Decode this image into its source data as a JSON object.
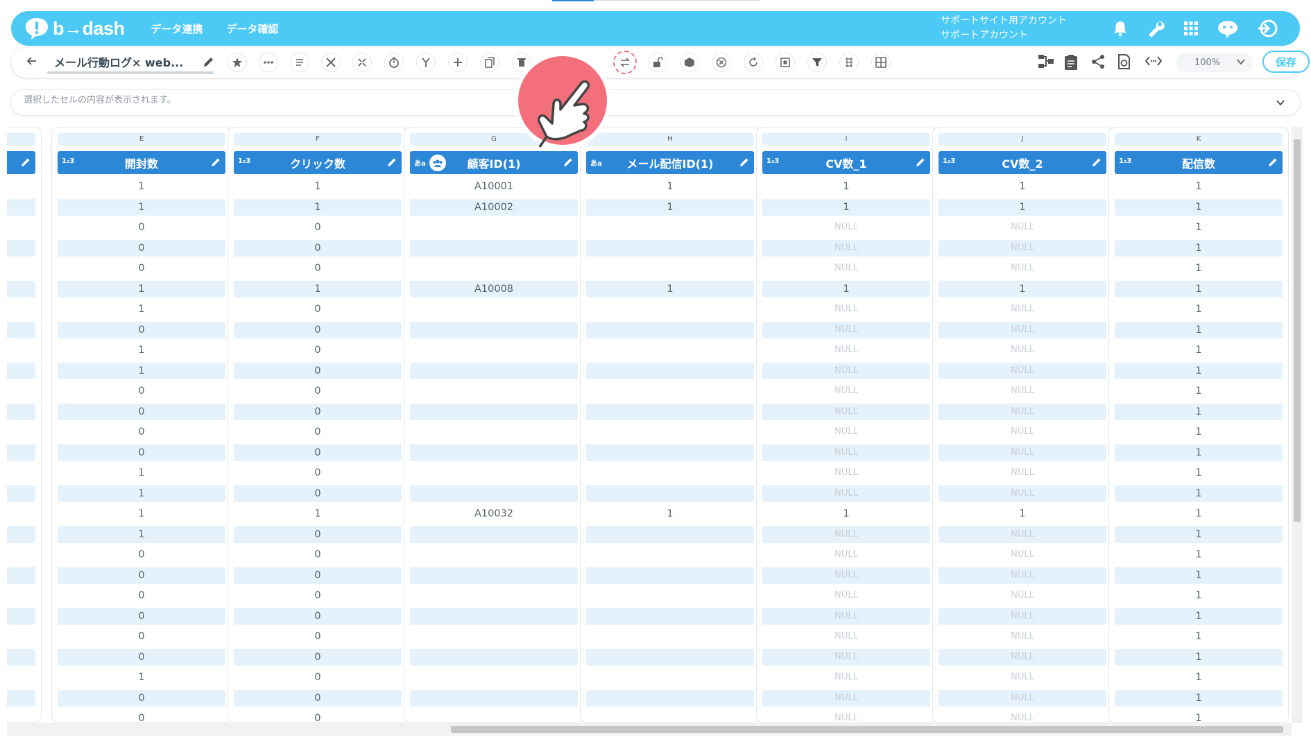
{
  "app": {
    "logo_text": "b→dash",
    "nav": [
      "データ連携",
      "データ確認"
    ],
    "account_line1": "サポートサイト用アカウント",
    "account_line2": "サポートアカウント"
  },
  "toolbar": {
    "title": "メール行動ログ× web...",
    "zoom": "100%",
    "save_label": "保存"
  },
  "formula": {
    "placeholder": "選択したセルの内容が表示されます。"
  },
  "columns": [
    {
      "letter": "",
      "name": "",
      "type": ""
    },
    {
      "letter": "E",
      "name": "開封数",
      "type": "1₂3"
    },
    {
      "letter": "F",
      "name": "クリック数",
      "type": "1₂3"
    },
    {
      "letter": "G",
      "name": "顧客ID(1)",
      "type": "あa"
    },
    {
      "letter": "H",
      "name": "メール配信ID(1)",
      "type": "あa"
    },
    {
      "letter": "I",
      "name": "CV数_1",
      "type": "1₂3"
    },
    {
      "letter": "J",
      "name": "CV数_2",
      "type": "1₂3"
    },
    {
      "letter": "K",
      "name": "配信数",
      "type": "1₂3"
    }
  ],
  "rows": [
    [
      "",
      "1",
      "1",
      "A10001",
      "1",
      "1",
      "1",
      "1"
    ],
    [
      "",
      "1",
      "1",
      "A10002",
      "1",
      "1",
      "1",
      "1"
    ],
    [
      "",
      "0",
      "0",
      "",
      "",
      "NULL",
      "NULL",
      "1"
    ],
    [
      "",
      "0",
      "0",
      "",
      "",
      "NULL",
      "NULL",
      "1"
    ],
    [
      "",
      "0",
      "0",
      "",
      "",
      "NULL",
      "NULL",
      "1"
    ],
    [
      "",
      "1",
      "1",
      "A10008",
      "1",
      "1",
      "1",
      "1"
    ],
    [
      "",
      "1",
      "0",
      "",
      "",
      "NULL",
      "NULL",
      "1"
    ],
    [
      "",
      "0",
      "0",
      "",
      "",
      "NULL",
      "NULL",
      "1"
    ],
    [
      "",
      "1",
      "0",
      "",
      "",
      "NULL",
      "NULL",
      "1"
    ],
    [
      "",
      "1",
      "0",
      "",
      "",
      "NULL",
      "NULL",
      "1"
    ],
    [
      "",
      "0",
      "0",
      "",
      "",
      "NULL",
      "NULL",
      "1"
    ],
    [
      "",
      "0",
      "0",
      "",
      "",
      "NULL",
      "NULL",
      "1"
    ],
    [
      "",
      "0",
      "0",
      "",
      "",
      "NULL",
      "NULL",
      "1"
    ],
    [
      "",
      "0",
      "0",
      "",
      "",
      "NULL",
      "NULL",
      "1"
    ],
    [
      "",
      "1",
      "0",
      "",
      "",
      "NULL",
      "NULL",
      "1"
    ],
    [
      "",
      "1",
      "0",
      "",
      "",
      "NULL",
      "NULL",
      "1"
    ],
    [
      "",
      "1",
      "1",
      "A10032",
      "1",
      "1",
      "1",
      "1"
    ],
    [
      "",
      "1",
      "0",
      "",
      "",
      "NULL",
      "NULL",
      "1"
    ],
    [
      "",
      "0",
      "0",
      "",
      "",
      "NULL",
      "NULL",
      "1"
    ],
    [
      "",
      "0",
      "0",
      "",
      "",
      "NULL",
      "NULL",
      "1"
    ],
    [
      "",
      "0",
      "0",
      "",
      "",
      "NULL",
      "NULL",
      "1"
    ],
    [
      "",
      "0",
      "0",
      "",
      "",
      "NULL",
      "NULL",
      "1"
    ],
    [
      "",
      "0",
      "0",
      "",
      "",
      "NULL",
      "NULL",
      "1"
    ],
    [
      "",
      "0",
      "0",
      "",
      "",
      "NULL",
      "NULL",
      "1"
    ],
    [
      "",
      "1",
      "0",
      "",
      "",
      "NULL",
      "NULL",
      "1"
    ],
    [
      "",
      "0",
      "0",
      "",
      "",
      "NULL",
      "NULL",
      "1"
    ],
    [
      "",
      "0",
      "0",
      "",
      "",
      "NULL",
      "NULL",
      "1"
    ]
  ],
  "icons": {
    "top": [
      "bell-icon",
      "wrench-icon",
      "grid-apps-icon",
      "chat-bot-icon",
      "logout-icon"
    ],
    "toolbar": [
      "star-icon",
      "more-icon",
      "memo-icon",
      "tools-icon",
      "expand-icon",
      "timer-icon",
      "merge-icon",
      "plus-icon",
      "copy-icon",
      "delete-icon",
      "swap-icon",
      "unlock-icon",
      "box-icon",
      "cancel-icon",
      "refresh-code-icon",
      "frame-icon",
      "filter-icon",
      "settings-grid-icon",
      "table-icon"
    ],
    "right": [
      "flow-icon",
      "clipboard-icon",
      "share-icon",
      "history-icon",
      "code-icon"
    ]
  },
  "colors": {
    "brand": "#4ccaf5",
    "header": "#2c87d6",
    "row_alt": "#e5f1fb",
    "pointer": "#f46f7c"
  }
}
